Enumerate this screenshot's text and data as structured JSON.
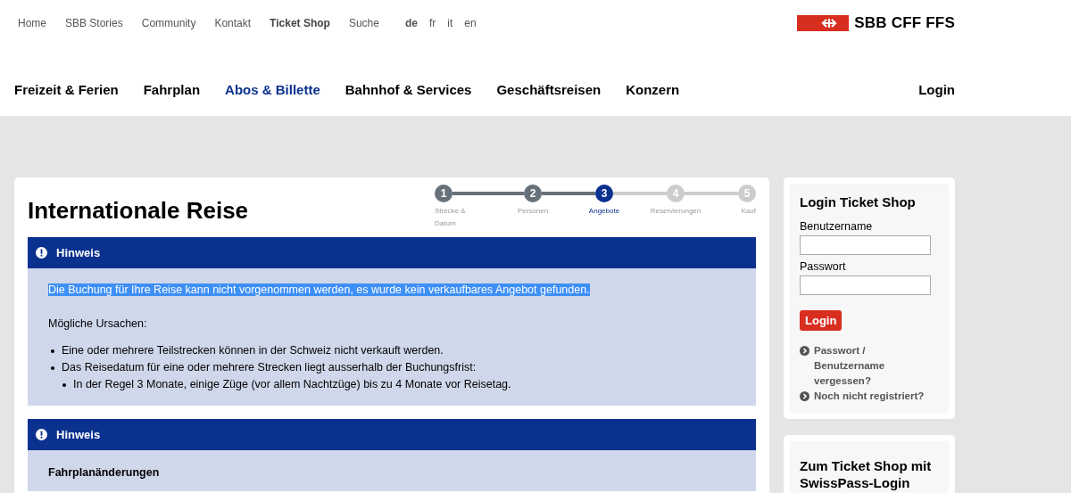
{
  "top_nav": [
    {
      "label": "Home",
      "selected": false
    },
    {
      "label": "SBB Stories",
      "selected": false
    },
    {
      "label": "Community",
      "selected": false
    },
    {
      "label": "Kontakt",
      "selected": false
    },
    {
      "label": "Ticket Shop",
      "selected": true
    },
    {
      "label": "Suche",
      "selected": false
    }
  ],
  "languages": [
    {
      "label": "de",
      "selected": true
    },
    {
      "label": "fr",
      "selected": false
    },
    {
      "label": "it",
      "selected": false
    },
    {
      "label": "en",
      "selected": false
    }
  ],
  "logo": {
    "text": "SBB CFF FFS"
  },
  "main_nav": [
    {
      "label": "Freizeit & Ferien",
      "selected": false
    },
    {
      "label": "Fahrplan",
      "selected": false
    },
    {
      "label": "Abos & Billette",
      "selected": true
    },
    {
      "label": "Bahnhof & Services",
      "selected": false
    },
    {
      "label": "Geschäftsreisen",
      "selected": false
    },
    {
      "label": "Konzern",
      "selected": false
    }
  ],
  "login_link": "Login",
  "page_title": "Internationale Reise",
  "steps": [
    {
      "number": "1",
      "label": "Strecke & Datum",
      "completed": true,
      "selected": false
    },
    {
      "number": "2",
      "label": "Personen",
      "completed": true,
      "selected": false
    },
    {
      "number": "3",
      "label": "Angebote",
      "completed": false,
      "selected": true
    },
    {
      "number": "4",
      "label": "Reservierungen",
      "completed": false,
      "selected": false
    },
    {
      "number": "5",
      "label": "Kauf",
      "completed": false,
      "selected": false
    }
  ],
  "notices": [
    {
      "title": "Hinweis",
      "message": "Die Buchung für Ihre Reise kann nicht vorgenommen werden, es wurde kein verkaufbares Angebot gefunden.",
      "highlighted": true,
      "subheading": "Mögliche Ursachen:",
      "causes": [
        {
          "text": "Eine oder mehrere Teilstrecken können in der Schweiz nicht verkauft werden."
        },
        {
          "text": "Das Reisedatum für eine oder mehrere Strecken liegt ausserhalb der Buchungsfrist:",
          "children": [
            {
              "text": "In der Regel 3 Monate, einige Züge (vor allem Nachtzüge) bis zu 4 Monate vor Reisetag."
            }
          ]
        }
      ]
    },
    {
      "title": "Hinweis",
      "heading": "Fahrplanänderungen"
    }
  ],
  "login_box": {
    "title": "Login Ticket Shop",
    "username_label": "Benutzername",
    "password_label": "Passwort",
    "button": "Login",
    "links": [
      "Passwort / Benutzername vergessen?",
      "Noch nicht registriert?"
    ]
  },
  "swisspass_box": {
    "title": "Zum Ticket Shop mit SwissPass-Login"
  }
}
